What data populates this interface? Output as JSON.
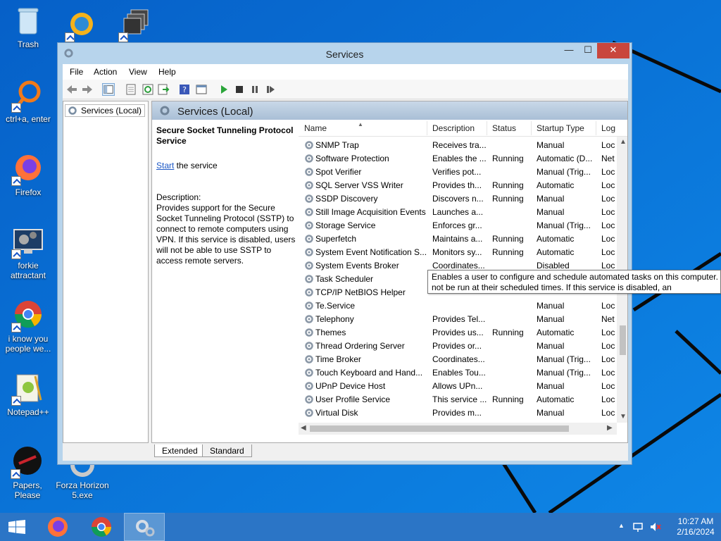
{
  "desktop": {
    "icons": [
      {
        "label": "Trash"
      },
      {
        "label": ""
      },
      {
        "label": ""
      },
      {
        "label": "ctrl+a, enter"
      },
      {
        "label": "Firefox"
      },
      {
        "label": "forkie attractant"
      },
      {
        "label": "i know you people we..."
      },
      {
        "label": "Notepad++"
      },
      {
        "label": "Papers, Please"
      },
      {
        "label": "Forza Horizon 5.exe"
      }
    ]
  },
  "window": {
    "title": "Services",
    "controls": {
      "minimize": "—",
      "maximize": "☐",
      "close": "✕"
    },
    "menu": [
      "File",
      "Action",
      "View",
      "Help"
    ],
    "tree_item": "Services (Local)",
    "pane_title": "Services (Local)",
    "detail": {
      "service_name": "Secure Socket Tunneling Protocol Service",
      "start_link": "Start",
      "start_rest": " the service",
      "description_label": "Description:",
      "description": "Provides support for the Secure Socket Tunneling Protocol (SSTP) to connect to remote computers using VPN. If this service is disabled, users will not be able to use SSTP to access remote servers."
    },
    "columns": [
      "Name",
      "Description",
      "Status",
      "Startup Type",
      "Log"
    ],
    "rows": [
      {
        "name": "SNMP Trap",
        "desc": "Receives tra...",
        "status": "",
        "startup": "Manual",
        "log": "Loc"
      },
      {
        "name": "Software Protection",
        "desc": "Enables the ...",
        "status": "Running",
        "startup": "Automatic (D...",
        "log": "Net"
      },
      {
        "name": "Spot Verifier",
        "desc": "Verifies pot...",
        "status": "",
        "startup": "Manual (Trig...",
        "log": "Loc"
      },
      {
        "name": "SQL Server VSS Writer",
        "desc": "Provides th...",
        "status": "Running",
        "startup": "Automatic",
        "log": "Loc"
      },
      {
        "name": "SSDP Discovery",
        "desc": "Discovers n...",
        "status": "Running",
        "startup": "Manual",
        "log": "Loc"
      },
      {
        "name": "Still Image Acquisition Events",
        "desc": "Launches a...",
        "status": "",
        "startup": "Manual",
        "log": "Loc"
      },
      {
        "name": "Storage Service",
        "desc": "Enforces gr...",
        "status": "",
        "startup": "Manual (Trig...",
        "log": "Loc"
      },
      {
        "name": "Superfetch",
        "desc": "Maintains a...",
        "status": "Running",
        "startup": "Automatic",
        "log": "Loc"
      },
      {
        "name": "System Event Notification S...",
        "desc": "Monitors sy...",
        "status": "Running",
        "startup": "Automatic",
        "log": "Loc"
      },
      {
        "name": "System Events Broker",
        "desc": "Coordinates...",
        "status": "",
        "startup": "Disabled",
        "log": "Loc"
      },
      {
        "name": "Task Scheduler",
        "desc": "",
        "status": "",
        "startup": "",
        "log": ""
      },
      {
        "name": "TCP/IP NetBIOS Helper",
        "desc": "",
        "status": "",
        "startup": "",
        "log": ""
      },
      {
        "name": "Te.Service",
        "desc": "",
        "status": "",
        "startup": "Manual",
        "log": "Loc"
      },
      {
        "name": "Telephony",
        "desc": "Provides Tel...",
        "status": "",
        "startup": "Manual",
        "log": "Net"
      },
      {
        "name": "Themes",
        "desc": "Provides us...",
        "status": "Running",
        "startup": "Automatic",
        "log": "Loc"
      },
      {
        "name": "Thread Ordering Server",
        "desc": "Provides or...",
        "status": "",
        "startup": "Manual",
        "log": "Loc"
      },
      {
        "name": "Time Broker",
        "desc": "Coordinates...",
        "status": "",
        "startup": "Manual (Trig...",
        "log": "Loc"
      },
      {
        "name": "Touch Keyboard and Hand...",
        "desc": "Enables Tou...",
        "status": "",
        "startup": "Manual (Trig...",
        "log": "Loc"
      },
      {
        "name": "UPnP Device Host",
        "desc": "Allows UPn...",
        "status": "",
        "startup": "Manual",
        "log": "Loc"
      },
      {
        "name": "User Profile Service",
        "desc": "This service ...",
        "status": "Running",
        "startup": "Automatic",
        "log": "Loc"
      },
      {
        "name": "Virtual Disk",
        "desc": "Provides m...",
        "status": "",
        "startup": "Manual",
        "log": "Loc"
      }
    ],
    "tooltip": {
      "line1": "Enables a user to configure and schedule automated tasks on this computer. T",
      "line2": "not be run at their scheduled times. If this service is disabled, an"
    },
    "tabs": [
      "Extended",
      "Standard"
    ]
  },
  "taskbar": {
    "clock_time": "10:27 AM",
    "clock_date": "2/16/2024"
  },
  "colors": {
    "desktop": "#0a6fd6",
    "taskbar": "#2b75c6",
    "close_button": "#c9463d"
  }
}
